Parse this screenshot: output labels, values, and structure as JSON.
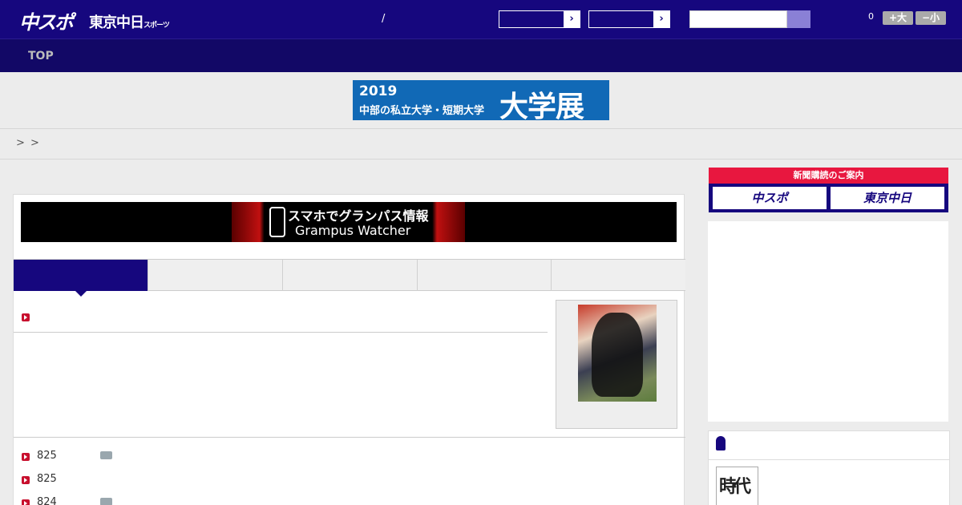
{
  "header": {
    "logo_chunichi_sports": "中スポ",
    "logo_tokyo_chunichi": "東京中日",
    "logo_tokyo_chunichi_small": "スポーツ",
    "slash": "/",
    "select_arrow": "›",
    "font_count": "0",
    "font_larger": "+大",
    "font_smaller": "−小"
  },
  "nav": {
    "top": "TOP"
  },
  "banner": {
    "year": "2019",
    "subtitle": "中部の私立大学・短期大学",
    "title": "大学展"
  },
  "breadcrumb": {
    "sep1": ">",
    "sep2": ">"
  },
  "grampus": {
    "line1": "スマホでグランパス情報",
    "line2": "Grampus Watcher"
  },
  "list": [
    {
      "num": "825",
      "camera": true
    },
    {
      "num": "825",
      "camera": false
    },
    {
      "num": "824",
      "camera": true
    }
  ],
  "subscribe": {
    "header": "新聞購読のご案内",
    "chunichi_sports": "中スポ",
    "tokyo_chunichi": "東京中日"
  },
  "sidebar_book": {
    "cover_text": "時代"
  },
  "colors": {
    "primary": "#16077e",
    "accent_red": "#e8173f",
    "banner_blue": "#1169b6"
  }
}
